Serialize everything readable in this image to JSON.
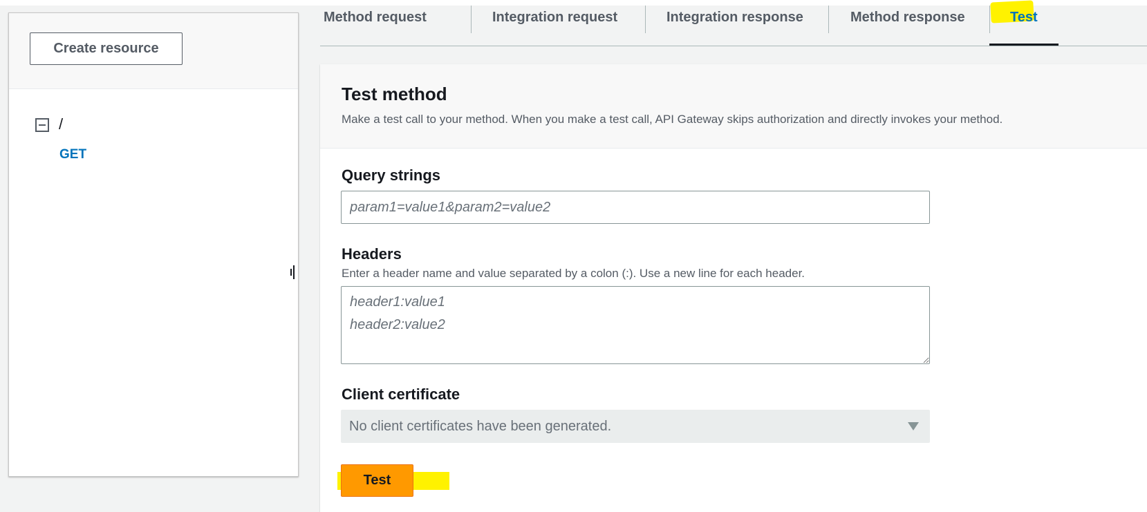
{
  "sidebar": {
    "create_resource_label": "Create resource",
    "tree": {
      "root_path": "/",
      "method": "GET"
    }
  },
  "tabs": [
    {
      "label": "Method request",
      "active": false
    },
    {
      "label": "Integration request",
      "active": false
    },
    {
      "label": "Integration response",
      "active": false
    },
    {
      "label": "Method response",
      "active": false
    },
    {
      "label": "Test",
      "active": true
    }
  ],
  "test_method": {
    "title": "Test method",
    "description": "Make a test call to your method. When you make a test call, API Gateway skips authorization and directly invokes your method.",
    "query_strings": {
      "label": "Query strings",
      "placeholder": "param1=value1&param2=value2",
      "value": ""
    },
    "headers": {
      "label": "Headers",
      "help": "Enter a header name and value separated by a colon (:). Use a new line for each header.",
      "placeholder": "header1:value1\nheader2:value2",
      "value": ""
    },
    "client_certificate": {
      "label": "Client certificate",
      "selected": "No client certificates have been generated.",
      "disabled": true
    },
    "submit_label": "Test"
  },
  "colors": {
    "accent_blue": "#0073bb",
    "primary_orange": "#ff9900",
    "highlight_yellow": "#fff200"
  },
  "icons": {
    "tree_toggle": "collapse-square-icon",
    "select_caret": "caret-down-icon"
  }
}
